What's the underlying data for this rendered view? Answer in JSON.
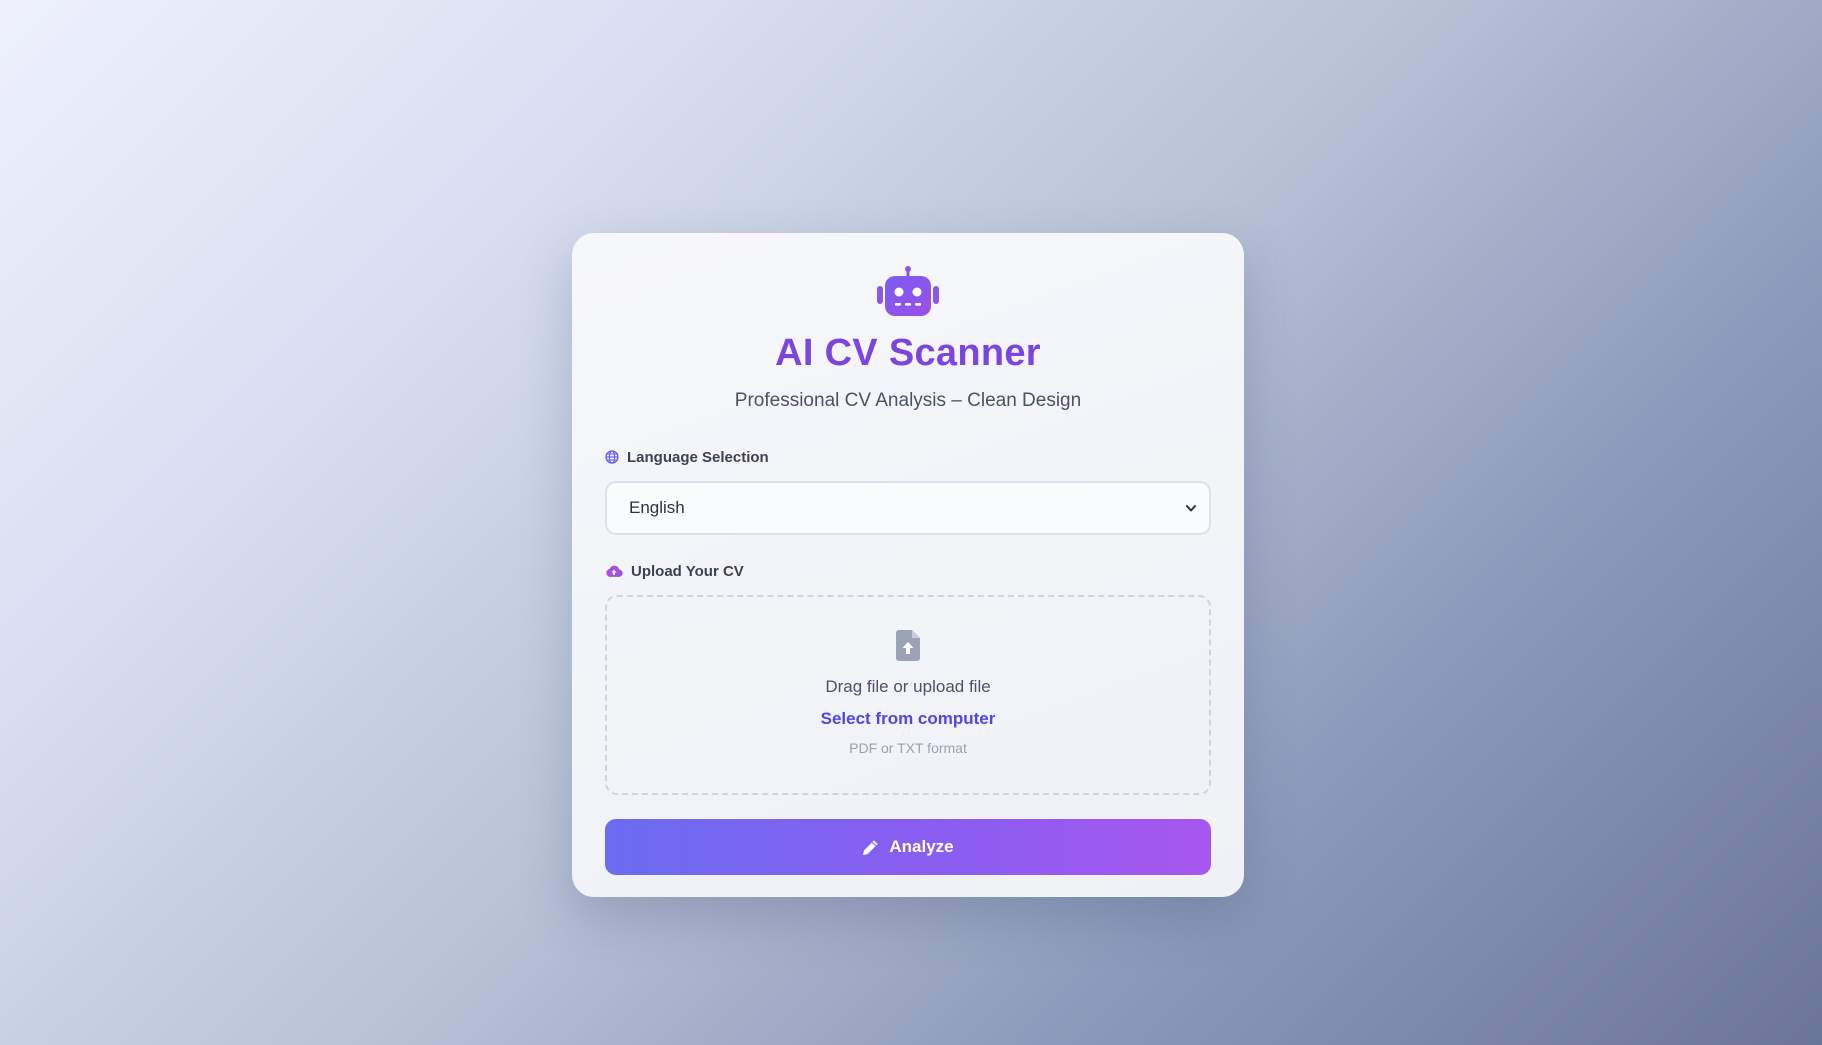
{
  "app": {
    "title": "AI CV Scanner",
    "subtitle": "Professional CV Analysis – Clean Design",
    "logo_icon": "robot-icon"
  },
  "language": {
    "label": "Language Selection",
    "icon": "globe-icon",
    "selected": "English"
  },
  "upload": {
    "label": "Upload Your CV",
    "icon": "cloud-upload-icon",
    "file_icon": "file-upload-icon",
    "drop_text": "Drag file or upload file",
    "select_link": "Select from computer",
    "format_hint": "PDF or TXT format"
  },
  "actions": {
    "analyze_label": "Analyze",
    "analyze_icon": "pencil-icon"
  },
  "colors": {
    "accent": "#7c45de",
    "link": "#4f46e5",
    "button_start": "#6b6cf0",
    "button_end": "#a757ef"
  }
}
